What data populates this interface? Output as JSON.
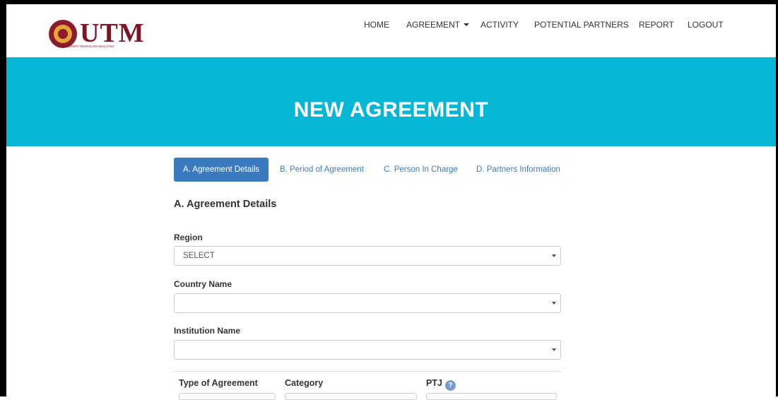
{
  "logo": {
    "title": "UTM",
    "subtitle": "UNIVERSITI TEKNOLOGI MALAYSIA"
  },
  "nav": {
    "home": "HOME",
    "agreement": "AGREEMENT",
    "activity": "ACTIVITY",
    "potential_partners": "POTENTIAL PARTNERS",
    "report": "REPORT",
    "logout": "LOGOUT"
  },
  "hero": {
    "title": "NEW AGREEMENT"
  },
  "tabs": [
    {
      "label": "A. Agreement Details",
      "active": true
    },
    {
      "label": "B. Period of Agreement",
      "active": false
    },
    {
      "label": "C. Person In Charge",
      "active": false
    },
    {
      "label": "D. Partners Information",
      "active": false
    }
  ],
  "form": {
    "section_title": "A. Agreement Details",
    "region": {
      "label": "Region",
      "value": "SELECT"
    },
    "country": {
      "label": "Country Name",
      "value": ""
    },
    "institution": {
      "label": "Institution Name",
      "value": ""
    },
    "columns": {
      "type": "Type of Agreement",
      "category": "Category",
      "ptj": "PTJ"
    }
  },
  "colors": {
    "accent": "#05b7d4",
    "tab_active": "#3a7bbf",
    "brand": "#7d1525"
  },
  "icons": {
    "help": "help-icon",
    "dropdown": "caret-down-icon"
  }
}
